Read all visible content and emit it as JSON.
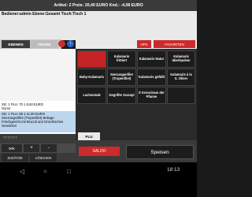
{
  "header": {
    "summary": "Artikel: 2   Preis: 20,40 EURO   Knd.: -4,08 EURO",
    "bediener_line": "Bediener:admin Ebene:Gesamt  Tisch:Tisch 1"
  },
  "tabs": {
    "ebenen": "EBENEN",
    "tische": "TISCHE"
  },
  "toolbar": {
    "hpk": "HPK",
    "favorites": "FAVORITEN"
  },
  "products": [
    "",
    "Kalamaris frittiert",
    "Kalamaris Natur",
    "Kalamaris überbacken",
    "Baby-Kalamaris",
    "Seezungenfilet (Tropenfilet)",
    "Kalamaris gefüllt",
    "Kalamaris à la S. Oliver",
    "Lachssteak",
    "Gegrillte Scampi",
    "Il Grecoiraus der Pfanne",
    ""
  ],
  "order": {
    "line1": "Stz: 1   PLU: 70   1   8,50 EURO",
    "line1b": "Gyros",
    "line2": "Stz: 1   PLU: 59   1   11,90 EURO",
    "line2c": "Seezungenfilet (Tropenfilet)  Beilage:",
    "line2d": "Frischgericht mit Brocoli und Griechisches Gewürzen"
  },
  "controls": {
    "arrows": "↑↑↑↑↑↑↑",
    "btn_90k": "90K",
    "plus": "+",
    "minus": "-",
    "zusatze": "ZUSÄTZE",
    "loschen": "LÖSCHEN",
    "plu": "PLU",
    "saldo": "SALDO",
    "speisen": "Speisen"
  },
  "system": {
    "clock": "18:13"
  },
  "colors": {
    "accent_red": "#cc2b2b",
    "selection_blue": "#bcd6ee"
  }
}
